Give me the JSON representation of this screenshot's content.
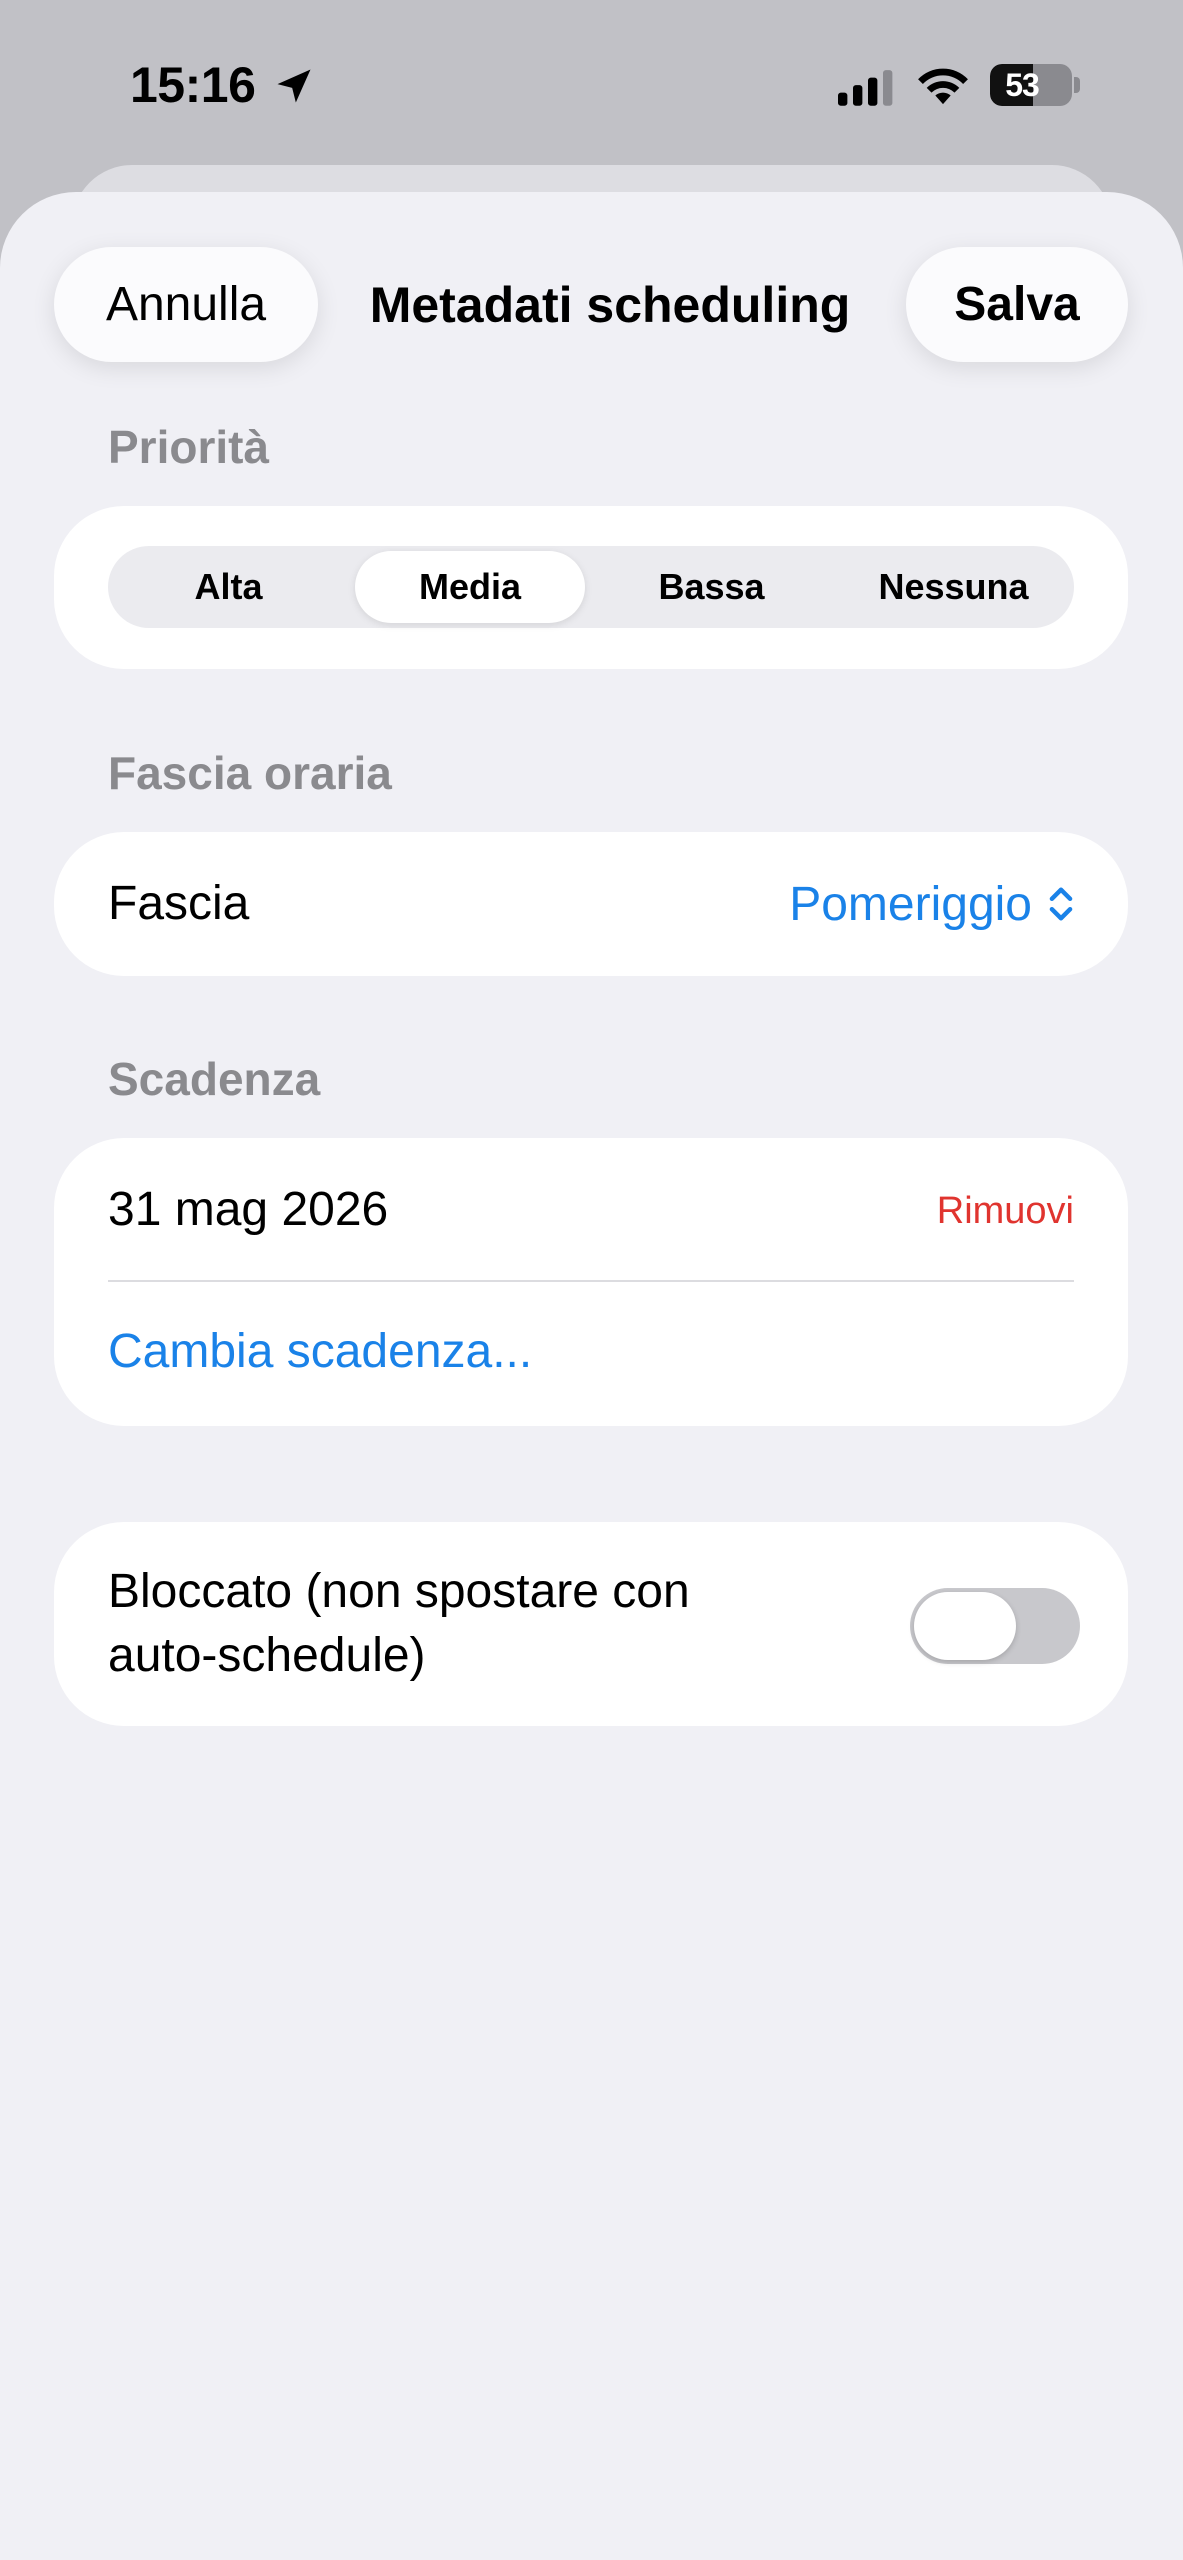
{
  "status_bar": {
    "time": "15:16",
    "battery_level": "53",
    "battery_fraction": 0.53
  },
  "header": {
    "cancel_label": "Annulla",
    "title": "Metadati scheduling",
    "save_label": "Salva"
  },
  "priority": {
    "section_title": "Priorità",
    "options": [
      "Alta",
      "Media",
      "Bassa",
      "Nessuna"
    ],
    "selected": "Media"
  },
  "time_slot": {
    "section_title": "Fascia oraria",
    "label": "Fascia",
    "value": "Pomeriggio"
  },
  "deadline": {
    "section_title": "Scadenza",
    "date": "31 mag 2026",
    "remove_label": "Rimuovi",
    "change_label": "Cambia scadenza..."
  },
  "lock": {
    "label_line1": "Bloccato (non spostare con",
    "label_line2": "auto-schedule)",
    "enabled": false
  },
  "colors": {
    "accent": "#1a82e8",
    "destructive": "#e0342f",
    "secondary_text": "#8a8a8e",
    "background": "#f0f0f5"
  }
}
